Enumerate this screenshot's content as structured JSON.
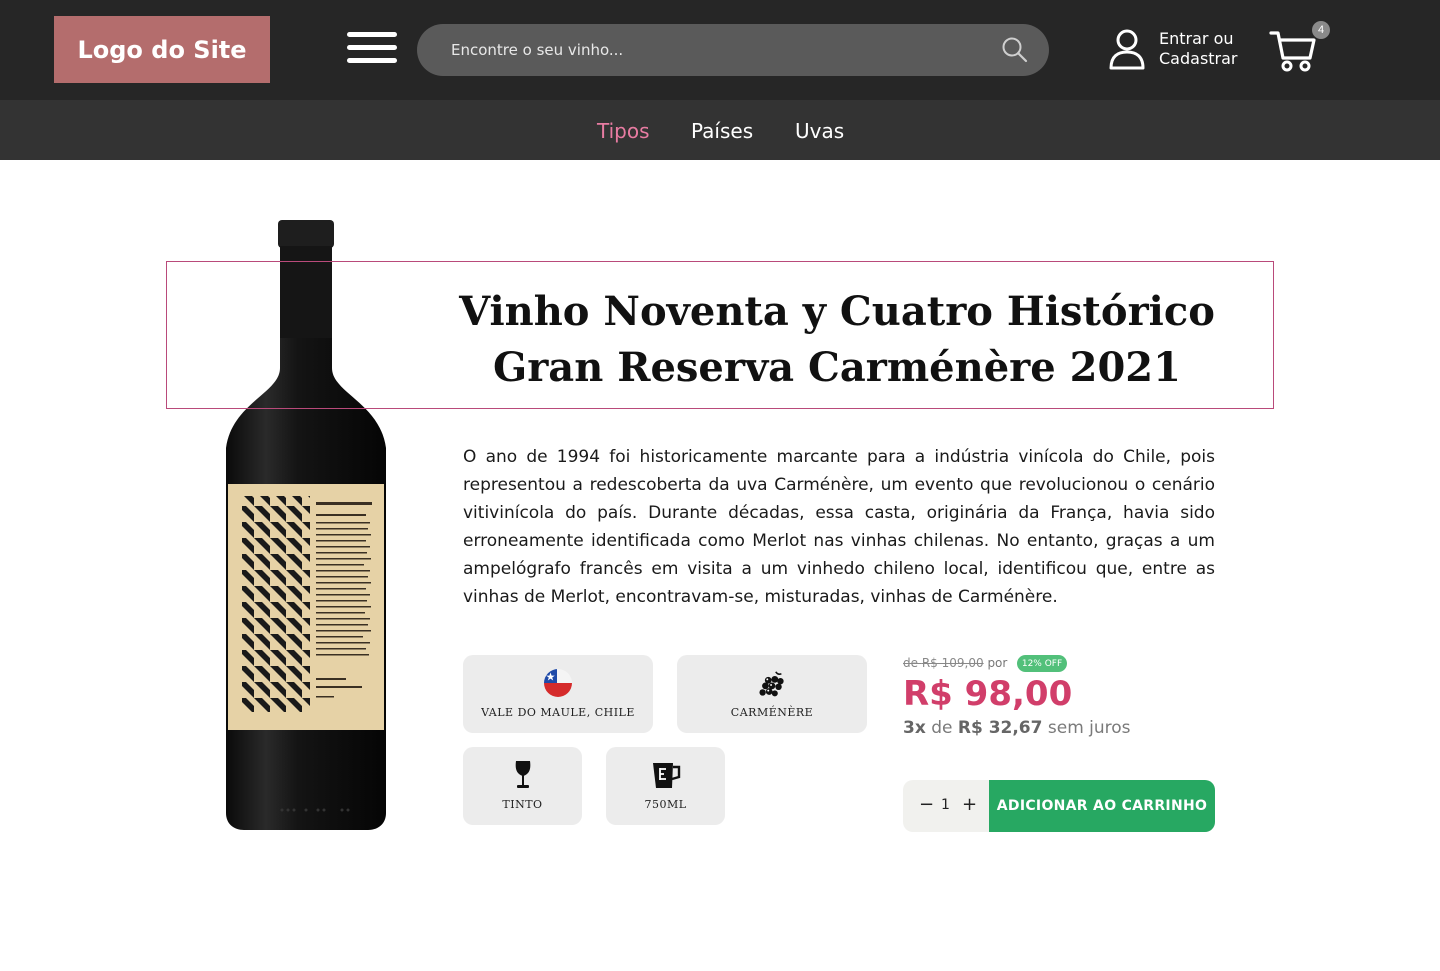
{
  "header": {
    "logo_text": "Logo do Site",
    "search_placeholder": "Encontre o seu vinho...",
    "login_line1": "Entrar ou",
    "login_line2": "Cadastrar",
    "cart_count": "4"
  },
  "nav": {
    "items": [
      "Tipos",
      "Países",
      "Uvas"
    ],
    "active": "Tipos"
  },
  "product": {
    "title_line1": "Vinho Noventa y Cuatro Histórico",
    "title_line2": "Gran Reserva Carménère 2021",
    "description": "O ano de 1994 foi historicamente marcante para a indústria vinícola do Chile, pois representou a redescoberta da uva Carménère, um evento que revolucionou o cenário vitivinícola do país. Durante décadas, essa casta, originária da França, havia sido erroneamente identificada como Merlot nas vinhas chilenas. No entanto, graças a um ampelógrafo francês em visita a um vinhedo chileno local, identificou que, entre as vinhas de Merlot, encontravam-se, misturadas, vinhas de Carménère.",
    "attributes": {
      "origin": "VALE DO MAULE, CHILE",
      "grape": "CARMÉNÈRE",
      "type": "TINTO",
      "volume": "750ML"
    },
    "pricing": {
      "old_price_prefix": "de",
      "old_price": "R$ 109,00",
      "old_price_suffix": "por",
      "discount_badge": "12% OFF",
      "price": "R$ 98,00",
      "installments_count": "3x",
      "installments_de": "de",
      "installment_value": "R$ 32,67",
      "installments_suffix": "sem juros"
    },
    "quantity": "1",
    "add_to_cart_label": "ADICIONAR AO CARRINHO"
  },
  "colors": {
    "header_bg": "#262626",
    "nav_bg": "#333333",
    "logo_bg": "#b46d6d",
    "accent_pink": "#d13e6a",
    "nav_active": "#e87ca2",
    "buy_green": "#27a862",
    "badge_green": "#52c07a"
  },
  "icons": [
    "menu-icon",
    "search-icon",
    "user-icon",
    "cart-icon",
    "chile-flag-icon",
    "grapes-icon",
    "wine-glass-icon",
    "measuring-jug-icon"
  ]
}
